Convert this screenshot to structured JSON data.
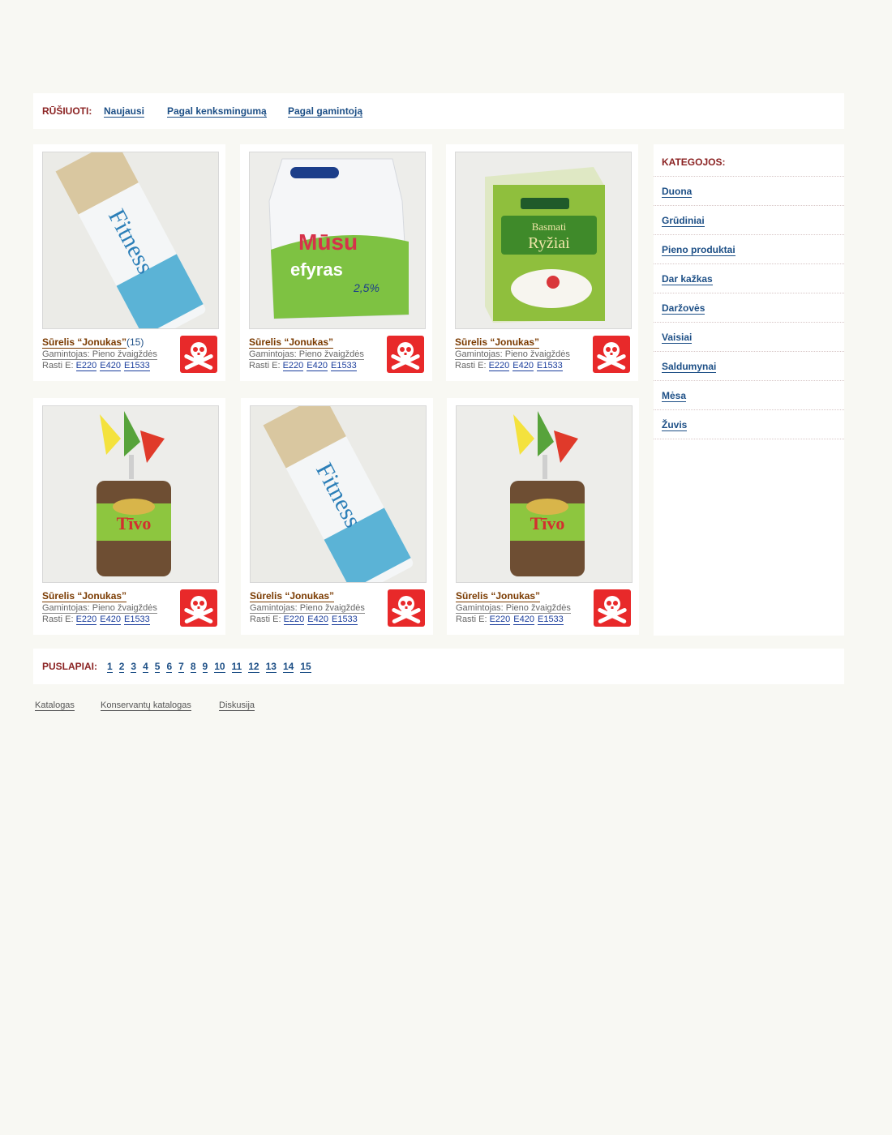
{
  "sort": {
    "label": "RŪŠIUOTI:",
    "options": [
      "Naujausi",
      "Pagal kenksmingumą",
      "Pagal gamintoją"
    ]
  },
  "products": [
    {
      "name": "Sūrelis “Jonukas”",
      "count": "(15)",
      "maker_label": "Gamintojas:",
      "maker": "Pieno žvaigždės",
      "found_label": "Rasti E:",
      "e_codes": [
        "E220",
        "E420",
        "E1533"
      ],
      "image": "fitness-bar-photo",
      "badge": "skull-icon"
    },
    {
      "name": "Sūrelis “Jonukas”",
      "count": "",
      "maker_label": "Gamintojas:",
      "maker": "Pieno žvaigždės",
      "found_label": "Rasti E:",
      "e_codes": [
        "E220",
        "E420",
        "E1533"
      ],
      "image": "kefir-pouch-photo",
      "badge": "skull-icon"
    },
    {
      "name": "Sūrelis “Jonukas”",
      "count": "",
      "maker_label": "Gamintojas:",
      "maker": "Pieno žvaigždės",
      "found_label": "Rasti E:",
      "e_codes": [
        "E220",
        "E420",
        "E1533"
      ],
      "image": "rice-box-photo",
      "badge": "skull-icon"
    },
    {
      "name": "Sūrelis “Jonukas”",
      "count": "",
      "maker_label": "Gamintojas:",
      "maker": "Pieno žvaigždės",
      "found_label": "Rasti E:",
      "e_codes": [
        "E220",
        "E420",
        "E1533"
      ],
      "image": "bread-bag-photo",
      "badge": "skull-icon"
    },
    {
      "name": "Sūrelis “Jonukas”",
      "count": "",
      "maker_label": "Gamintojas:",
      "maker": "Pieno žvaigždės",
      "found_label": "Rasti E:",
      "e_codes": [
        "E220",
        "E420",
        "E1533"
      ],
      "image": "fitness-bar-photo",
      "badge": "skull-icon"
    },
    {
      "name": "Sūrelis “Jonukas”",
      "count": "",
      "maker_label": "Gamintojas:",
      "maker": "Pieno žvaigždės",
      "found_label": "Rasti E:",
      "e_codes": [
        "E220",
        "E420",
        "E1533"
      ],
      "image": "bread-bag-photo",
      "badge": "skull-icon"
    }
  ],
  "sidebar": {
    "title": "KATEGOJOS:",
    "categories": [
      "Duona",
      "Grūdiniai",
      "Pieno produktai",
      "Dar kažkas",
      "Daržovės",
      "Vaisiai",
      "Saldumynai",
      "Mėsa",
      "Žuvis"
    ]
  },
  "pager": {
    "label": "PUSLAPIAI:",
    "pages": [
      "1",
      "2",
      "3",
      "4",
      "5",
      "6",
      "7",
      "8",
      "9",
      "10",
      "11",
      "12",
      "13",
      "14",
      "15"
    ]
  },
  "footer": {
    "links": [
      "Katalogas",
      "Konservantų katalogas",
      "Diskusija"
    ]
  },
  "colors": {
    "background": "#f8f8f3",
    "heading": "#8b2323",
    "link": "#1d4f86",
    "product_name": "#7a3a00",
    "danger": "#e8292a"
  }
}
